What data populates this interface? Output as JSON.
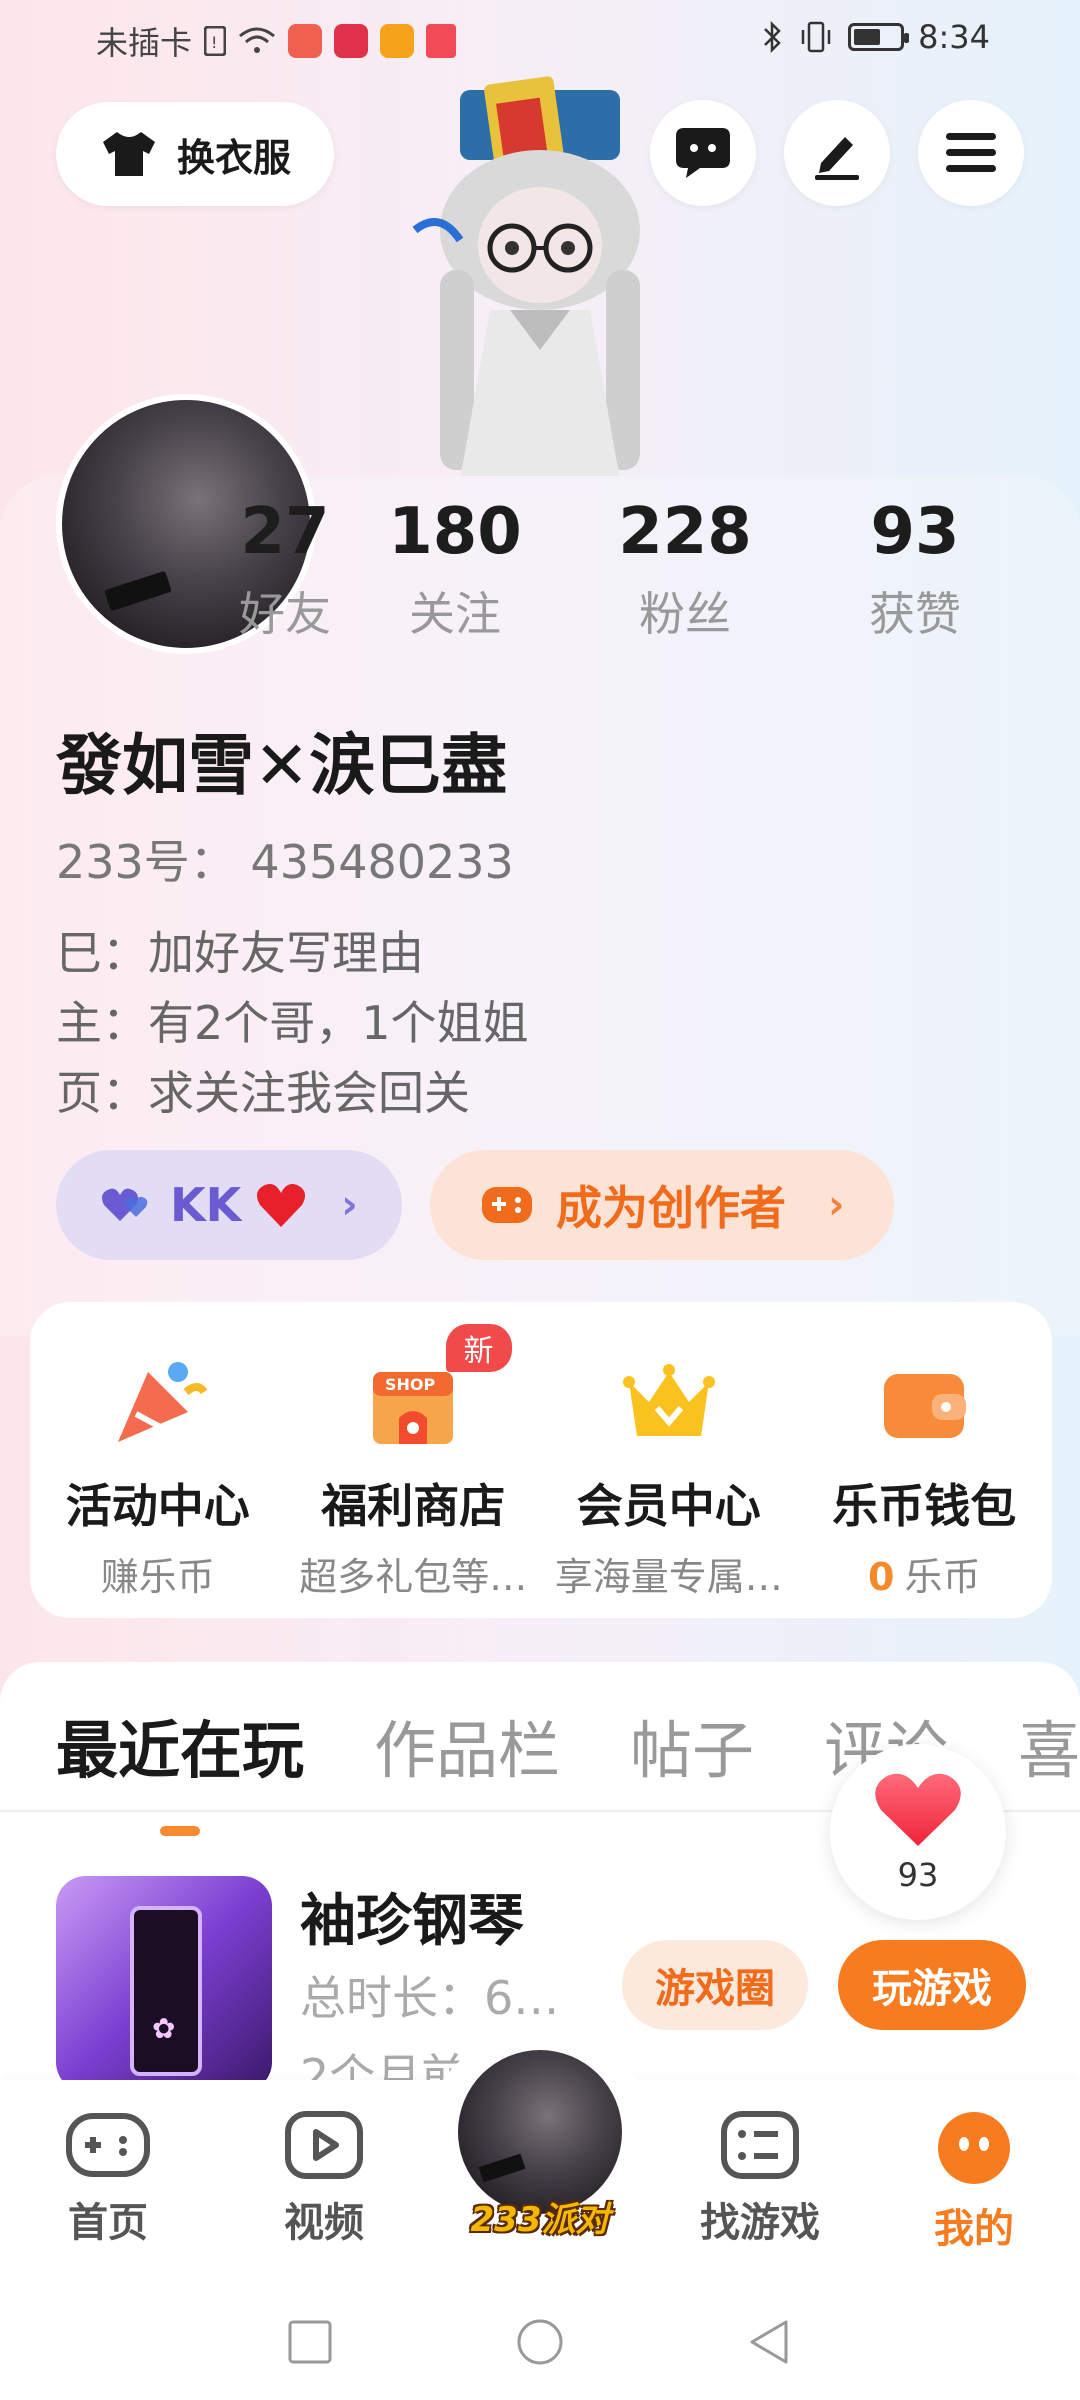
{
  "status_bar": {
    "carrier": "未插卡",
    "time": "8:34",
    "battery_level": 0.6,
    "app_icons": [
      "sim-icon",
      "wifi-icon",
      "app-red-icon",
      "app-heart-icon",
      "app-orange-play-icon",
      "app-book-icon"
    ]
  },
  "header": {
    "dress_label": "换衣服",
    "icons": [
      "chat-bubble-icon",
      "edit-pen-icon",
      "menu-icon"
    ]
  },
  "profile": {
    "stats": [
      {
        "num": "27",
        "label": "好友"
      },
      {
        "num": "180",
        "label": "关注"
      },
      {
        "num": "228",
        "label": "粉丝"
      },
      {
        "num": "93",
        "label": "获赞"
      }
    ],
    "name": "發如雪✕涙巳盡",
    "id_line": "233号：  435480233",
    "bio": [
      "巳：加好友写理由",
      "主：有2个哥，1个姐姐",
      "页：求关注我会回关"
    ],
    "kk_label": "KK",
    "creator_label": "成为创作者"
  },
  "services": [
    {
      "title": "活动中心",
      "sub": "赚乐币"
    },
    {
      "title": "福利商店",
      "sub": "超多礼包等…",
      "badge": "新"
    },
    {
      "title": "会员中心",
      "sub": "享海量专属…"
    },
    {
      "title": "乐币钱包",
      "sub_value": "0",
      "sub": "乐币"
    }
  ],
  "tabs": [
    "最近在玩",
    "作品栏",
    "帖子",
    "评论",
    "喜"
  ],
  "recent_game": {
    "title": "袖珍钢琴",
    "duration": "总时长：6…",
    "updated": "2个月前",
    "circle_btn": "游戏圈",
    "play_btn": "玩游戏"
  },
  "like_float": {
    "count": "93"
  },
  "bottom_nav": [
    {
      "label": "首页",
      "icon": "gamepad-icon"
    },
    {
      "label": "视频",
      "icon": "video-play-icon"
    },
    {
      "label": "233派对",
      "icon": "party-avatar"
    },
    {
      "label": "找游戏",
      "icon": "list-icon"
    },
    {
      "label": "我的",
      "icon": "me-face-icon"
    }
  ],
  "colors": {
    "accent": "#f77b1f",
    "purple": "#6a5bd2",
    "badge_red": "#f04a4a"
  }
}
